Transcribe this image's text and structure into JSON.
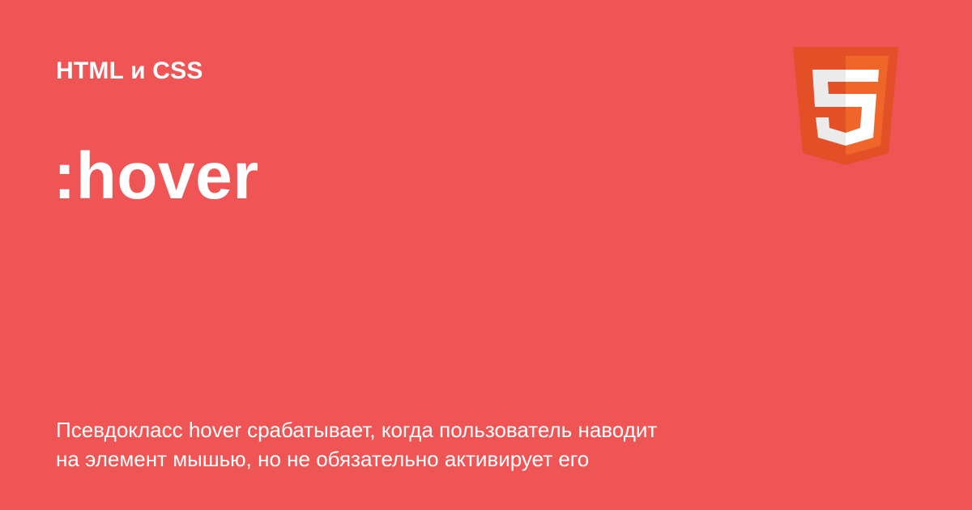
{
  "card": {
    "category": "HTML и CSS",
    "title": ":hover",
    "description_lines": [
      "Псевдокласс hover срабатывает, когда пользователь наводит",
      "на элемент мышью, но не обязательно активирует его"
    ],
    "logo_icon": "html5-logo-icon",
    "colors": {
      "background": "#f05555",
      "text": "#ffffff",
      "logo_dark": "#e34f26",
      "logo_light": "#f06529",
      "logo_digit_dark": "#ebebeb",
      "logo_digit_light": "#ffffff"
    }
  }
}
